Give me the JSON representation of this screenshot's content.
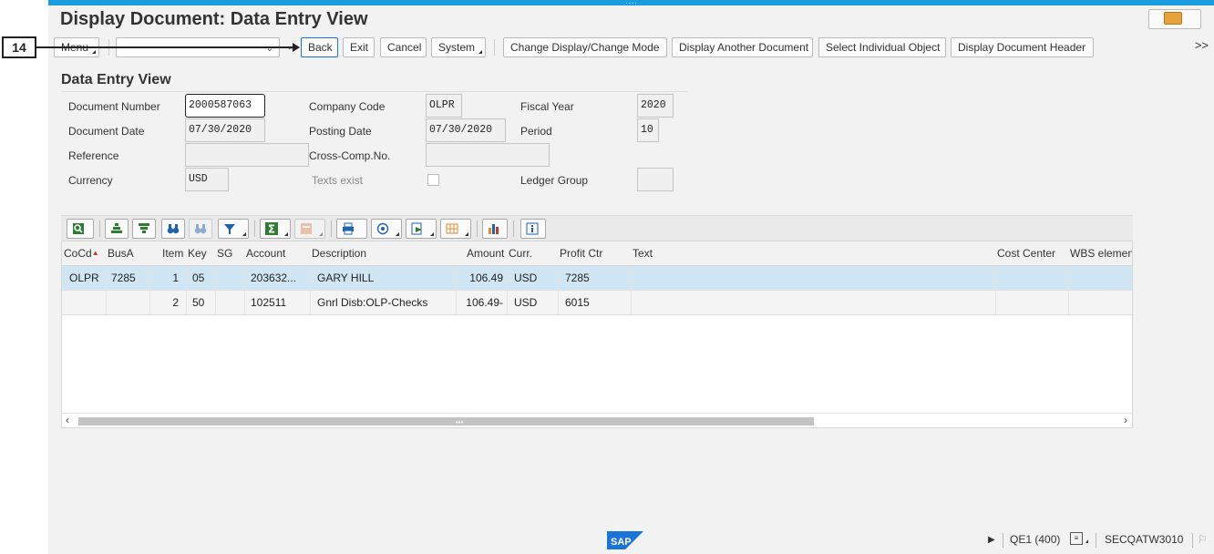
{
  "window": {
    "title": "Display Document: Data Entry View"
  },
  "callout": {
    "number": "14"
  },
  "toolbar": {
    "menu_label": "Menu",
    "command_value": "",
    "back_label": "Back",
    "exit_label": "Exit",
    "cancel_label": "Cancel",
    "system_label": "System",
    "change_mode_label": "Change Display/Change Mode",
    "another_doc_label": "Display Another Document",
    "select_object_label": "Select Individual Object",
    "doc_header_label": "Display Document Header",
    "overflow_label": ">>"
  },
  "header": {
    "section_title": "Data Entry View",
    "fields": {
      "document_number": {
        "label": "Document Number",
        "value": "2000587063"
      },
      "company_code": {
        "label": "Company Code",
        "value": "OLPR"
      },
      "fiscal_year": {
        "label": "Fiscal Year",
        "value": "2020"
      },
      "document_date": {
        "label": "Document Date",
        "value": "07/30/2020"
      },
      "posting_date": {
        "label": "Posting Date",
        "value": "07/30/2020"
      },
      "period": {
        "label": "Period",
        "value": "10"
      },
      "reference": {
        "label": "Reference",
        "value": ""
      },
      "cross_comp": {
        "label": "Cross-Comp.No.",
        "value": ""
      },
      "currency": {
        "label": "Currency",
        "value": "USD"
      },
      "texts_exist": {
        "label": "Texts exist",
        "checked": false
      },
      "ledger_group": {
        "label": "Ledger Group",
        "value": ""
      }
    }
  },
  "grid": {
    "columns": [
      "CoCd",
      "BusA",
      "Item",
      "Key",
      "SG",
      "Account",
      "Description",
      "Amount",
      "Curr.",
      "Profit Ctr",
      "Text",
      "Cost Center",
      "WBS elemen"
    ],
    "rows": [
      {
        "cocd": "OLPR",
        "busa": "7285",
        "item": "1",
        "key": "05",
        "sg": "",
        "account": "203632...",
        "description": "GARY HILL",
        "amount": "106.49",
        "curr": "USD",
        "profit_ctr": "7285",
        "text": "",
        "cost_center": "",
        "wbs": ""
      },
      {
        "cocd": "",
        "busa": "",
        "item": "2",
        "key": "50",
        "sg": "",
        "account": "102511",
        "description": "Gnrl Disb:OLP-Checks",
        "amount": "106.49-",
        "curr": "USD",
        "profit_ctr": "6015",
        "text": "",
        "cost_center": "",
        "wbs": ""
      }
    ]
  },
  "status": {
    "system": "QE1 (400)",
    "user": "SECQATW3010"
  },
  "colors": {
    "top_accent": "#1a9ce0",
    "selected_row": "#d1e6f4",
    "sap_blue": "#1a73d9"
  }
}
